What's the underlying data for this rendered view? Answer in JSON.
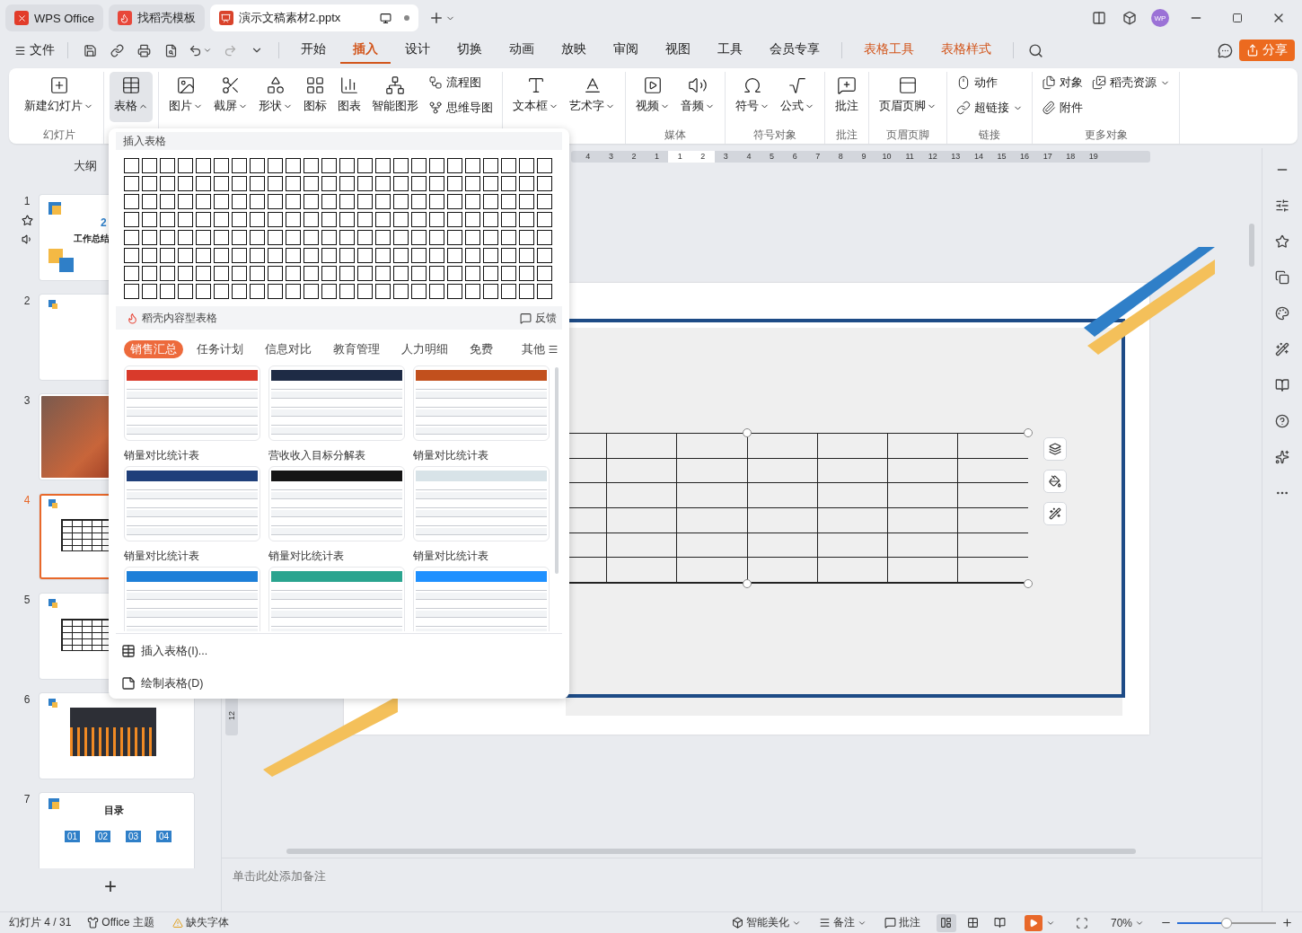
{
  "title_bar": {
    "tabs": [
      {
        "label": "WPS Office",
        "kind": "home",
        "selected": false
      },
      {
        "label": "找稻壳模板",
        "kind": "docer",
        "selected": false
      },
      {
        "label": "演示文稿素材2.pptx",
        "kind": "doc",
        "selected": true
      }
    ],
    "avatar": "WP"
  },
  "menu_bar": {
    "file": "文件",
    "tabs": [
      {
        "label": "开始",
        "kind": "main",
        "selected": false
      },
      {
        "label": "插入",
        "kind": "main",
        "selected": true
      },
      {
        "label": "设计",
        "kind": "main",
        "selected": false
      },
      {
        "label": "切换",
        "kind": "main",
        "selected": false
      },
      {
        "label": "动画",
        "kind": "main",
        "selected": false
      },
      {
        "label": "放映",
        "kind": "main",
        "selected": false
      },
      {
        "label": "审阅",
        "kind": "main",
        "selected": false
      },
      {
        "label": "视图",
        "kind": "main",
        "selected": false
      },
      {
        "label": "工具",
        "kind": "main",
        "selected": false
      },
      {
        "label": "会员专享",
        "kind": "main",
        "selected": false
      },
      {
        "label": "表格工具",
        "kind": "context",
        "selected": false
      },
      {
        "label": "表格样式",
        "kind": "context",
        "selected": false
      }
    ],
    "share": "分享"
  },
  "ribbon": {
    "groups": [
      {
        "label": "幻灯片",
        "items": [
          {
            "label": "新建幻灯片",
            "kind": "large",
            "caret": true,
            "pressed": false
          }
        ]
      },
      {
        "items": [
          {
            "label": "表格",
            "kind": "large",
            "caret": true,
            "pressed": true
          }
        ]
      },
      {
        "items": [
          {
            "label": "图片",
            "kind": "large",
            "caret": true,
            "pressed": false
          },
          {
            "label": "截屏",
            "kind": "large",
            "caret": true,
            "pressed": false
          },
          {
            "label": "形状",
            "kind": "large",
            "caret": true,
            "pressed": false
          },
          {
            "label": "图标",
            "kind": "large",
            "caret": false,
            "pressed": false
          },
          {
            "label": "图表",
            "kind": "large",
            "caret": false,
            "pressed": false
          },
          {
            "label": "智能图形",
            "kind": "large",
            "caret": false,
            "pressed": false
          },
          {
            "label": "流程图",
            "kind": "small",
            "caret": false,
            "pressed": false
          },
          {
            "label": "思维导图",
            "kind": "small",
            "caret": false,
            "pressed": false
          }
        ]
      },
      {
        "items": [
          {
            "label": "文本框",
            "kind": "large",
            "caret": true,
            "pressed": false
          },
          {
            "label": "艺术字",
            "kind": "large",
            "caret": true,
            "pressed": false
          }
        ]
      },
      {
        "label": "媒体",
        "items": [
          {
            "label": "视频",
            "kind": "large",
            "caret": true,
            "pressed": false
          },
          {
            "label": "音频",
            "kind": "large",
            "caret": true,
            "pressed": false
          }
        ]
      },
      {
        "label": "符号对象",
        "items": [
          {
            "label": "符号",
            "kind": "large",
            "caret": true,
            "pressed": false
          },
          {
            "label": "公式",
            "kind": "large",
            "caret": true,
            "pressed": false
          }
        ]
      },
      {
        "label": "批注",
        "items": [
          {
            "label": "批注",
            "kind": "large",
            "caret": false,
            "pressed": false
          }
        ]
      },
      {
        "label": "页眉页脚",
        "items": [
          {
            "label": "页眉页脚",
            "kind": "large",
            "caret": true,
            "pressed": false
          }
        ]
      },
      {
        "label": "链接",
        "items": [
          {
            "label": "动作",
            "kind": "small",
            "caret": false,
            "pressed": false
          },
          {
            "label": "超链接",
            "kind": "small",
            "caret": true,
            "pressed": false
          }
        ]
      },
      {
        "label": "更多对象",
        "items": [
          {
            "label": "对象",
            "kind": "small",
            "caret": false,
            "pressed": false
          },
          {
            "label": "附件",
            "kind": "small",
            "caret": false,
            "pressed": false
          },
          {
            "label": "稻壳资源",
            "kind": "small",
            "caret": true,
            "pressed": false
          }
        ]
      }
    ]
  },
  "slide_panel": {
    "header": "大纲",
    "slides": [
      {
        "number": "1",
        "kind": "title",
        "selected": false,
        "transition": true,
        "texts": [
          "2",
          "工作总结"
        ]
      },
      {
        "number": "2",
        "kind": "blank",
        "selected": false,
        "transition": false
      },
      {
        "number": "3",
        "kind": "photo",
        "selected": false,
        "transition": false
      },
      {
        "number": "4",
        "kind": "table",
        "selected": true,
        "transition": false
      },
      {
        "number": "5",
        "kind": "table",
        "selected": false,
        "transition": false
      },
      {
        "number": "6",
        "kind": "chart",
        "selected": false,
        "transition": false
      },
      {
        "number": "7",
        "kind": "agenda",
        "selected": false,
        "transition": false,
        "texts": [
          "目录",
          "01",
          "02",
          "03",
          "04"
        ]
      }
    ],
    "add": "+"
  },
  "ruler": {
    "marks": [
      {
        "label": "4",
        "highlighted": false
      },
      {
        "label": "3",
        "highlighted": false
      },
      {
        "label": "2",
        "highlighted": false
      },
      {
        "label": "1",
        "highlighted": false
      },
      {
        "label": "1",
        "highlighted": true
      },
      {
        "label": "2",
        "highlighted": true
      },
      {
        "label": "3",
        "highlighted": false
      },
      {
        "label": "4",
        "highlighted": false
      },
      {
        "label": "5",
        "highlighted": false
      },
      {
        "label": "6",
        "highlighted": false
      },
      {
        "label": "7",
        "highlighted": false
      },
      {
        "label": "8",
        "highlighted": false
      },
      {
        "label": "9",
        "highlighted": false
      },
      {
        "label": "10",
        "highlighted": false
      },
      {
        "label": "11",
        "highlighted": false
      },
      {
        "label": "12",
        "highlighted": false
      },
      {
        "label": "13",
        "highlighted": false
      },
      {
        "label": "14",
        "highlighted": false
      },
      {
        "label": "15",
        "highlighted": false
      },
      {
        "label": "16",
        "highlighted": false
      },
      {
        "label": "17",
        "highlighted": false
      },
      {
        "label": "18",
        "highlighted": false
      },
      {
        "label": "19",
        "highlighted": false
      }
    ],
    "vertical_mark": "12"
  },
  "notes": {
    "placeholder": "单击此处添加备注"
  },
  "table_dropdown": {
    "title": "插入表格",
    "docer_label": "稻壳内容型表格",
    "feedback": "反馈",
    "categories": [
      {
        "label": "销售汇总",
        "selected": true
      },
      {
        "label": "任务计划",
        "selected": false
      },
      {
        "label": "信息对比",
        "selected": false
      },
      {
        "label": "教育管理",
        "selected": false
      },
      {
        "label": "人力明细",
        "selected": false
      },
      {
        "label": "免费",
        "selected": false
      }
    ],
    "more": "其他",
    "templates": [
      {
        "title": "销量对比统计表",
        "color": "#d93a2b"
      },
      {
        "title": "营收收入目标分解表",
        "color": "#1e2b45"
      },
      {
        "title": "销量对比统计表",
        "color": "#c2501d"
      },
      {
        "title": "销量对比统计表",
        "color": "#1f3f7a"
      },
      {
        "title": "销量对比统计表",
        "color": "#151515"
      },
      {
        "title": "销量对比统计表",
        "color": "#d8e3e8"
      },
      {
        "color": "#1d7fd8"
      },
      {
        "color": "#2aa48f"
      },
      {
        "color": "#1e90ff"
      }
    ],
    "actions": [
      "插入表格(I)...",
      "绘制表格(D)"
    ]
  },
  "status_bar": {
    "slide_info": "幻灯片 4 / 31",
    "theme": "Office 主题",
    "missing_font": "缺失字体",
    "beautify": "智能美化",
    "notes": "备注",
    "comments": "批注",
    "views": [
      {
        "selected": true
      },
      {
        "selected": false
      },
      {
        "selected": false
      }
    ],
    "zoom": "70%",
    "zoom_slider": {
      "level": 0.5
    }
  }
}
